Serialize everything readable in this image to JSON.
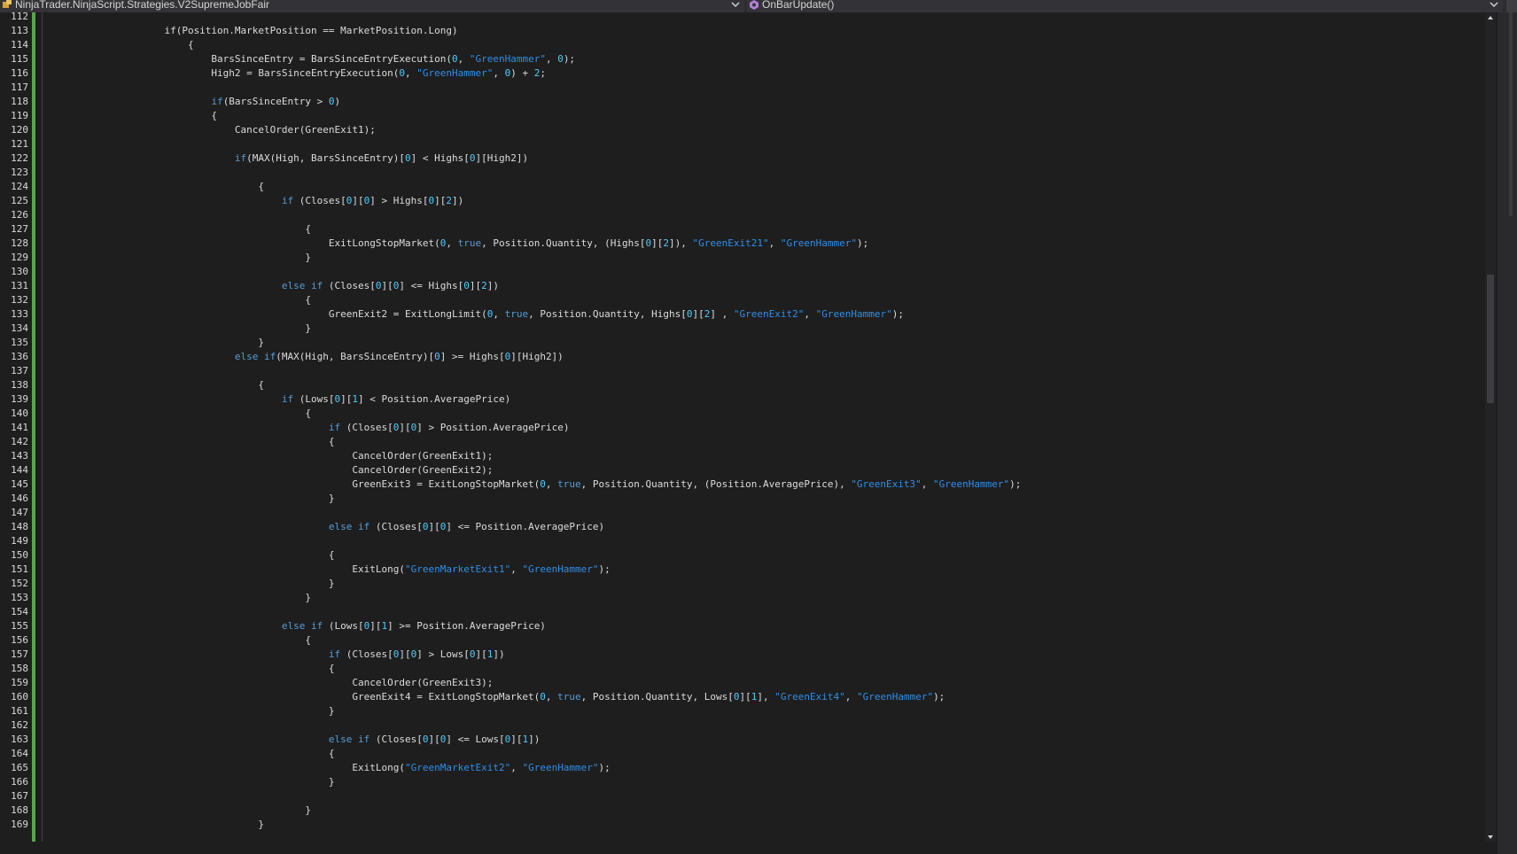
{
  "nav": {
    "type_dropdown": "NinjaTrader.NinjaScript.Strategies.V2SupremeJobFair",
    "member_dropdown": "OnBarUpdate()"
  },
  "icons": {
    "type_icon": "class-icon",
    "member_icon": "method-icon",
    "chevron": "chevron-down-icon"
  },
  "colors": {
    "background": "#1e1e1e",
    "keyword": "#569cd6",
    "string": "#2f8ee8",
    "number": "#4ec9ff",
    "change_bar": "#57a64a"
  },
  "editor": {
    "lines": [
      {
        "n": "112",
        "t": []
      },
      {
        "n": "113",
        "t": [
          [
            "",
            "                    if(Position.MarketPosition == MarketPosition.Long)"
          ]
        ]
      },
      {
        "n": "114",
        "t": [
          [
            "",
            "                        {"
          ]
        ]
      },
      {
        "n": "115",
        "t": [
          [
            "",
            "                            BarsSinceEntry = BarsSinceEntryExecution("
          ],
          [
            "n",
            "0"
          ],
          [
            "",
            ", "
          ],
          [
            "str",
            "\"GreenHammer\""
          ],
          [
            "",
            ", "
          ],
          [
            "n",
            "0"
          ],
          [
            "",
            ");"
          ]
        ]
      },
      {
        "n": "116",
        "t": [
          [
            "",
            "                            High2 = BarsSinceEntryExecution("
          ],
          [
            "n",
            "0"
          ],
          [
            "",
            ", "
          ],
          [
            "str",
            "\"GreenHammer\""
          ],
          [
            "",
            ", "
          ],
          [
            "n",
            "0"
          ],
          [
            "",
            ") + "
          ],
          [
            "n",
            "2"
          ],
          [
            "",
            ";"
          ]
        ]
      },
      {
        "n": "117",
        "t": []
      },
      {
        "n": "118",
        "t": [
          [
            "",
            "                            "
          ],
          [
            "kw",
            "if"
          ],
          [
            "",
            "(BarsSinceEntry > "
          ],
          [
            "n",
            "0"
          ],
          [
            "",
            ")"
          ]
        ]
      },
      {
        "n": "119",
        "t": [
          [
            "",
            "                            {"
          ]
        ]
      },
      {
        "n": "120",
        "t": [
          [
            "",
            "                                CancelOrder(GreenExit1);"
          ]
        ]
      },
      {
        "n": "121",
        "t": []
      },
      {
        "n": "122",
        "t": [
          [
            "",
            "                                "
          ],
          [
            "kw",
            "if"
          ],
          [
            "",
            "(MAX(High, BarsSinceEntry)["
          ],
          [
            "n",
            "0"
          ],
          [
            "",
            "] < Highs["
          ],
          [
            "n",
            "0"
          ],
          [
            "",
            "][High2])"
          ]
        ]
      },
      {
        "n": "123",
        "t": []
      },
      {
        "n": "124",
        "t": [
          [
            "",
            "                                    {"
          ]
        ]
      },
      {
        "n": "125",
        "t": [
          [
            "",
            "                                        "
          ],
          [
            "kw",
            "if"
          ],
          [
            "",
            " (Closes["
          ],
          [
            "n",
            "0"
          ],
          [
            "",
            "]["
          ],
          [
            "n",
            "0"
          ],
          [
            "",
            "] > Highs["
          ],
          [
            "n",
            "0"
          ],
          [
            "",
            "]["
          ],
          [
            "n",
            "2"
          ],
          [
            "",
            "])"
          ]
        ]
      },
      {
        "n": "126",
        "t": []
      },
      {
        "n": "127",
        "t": [
          [
            "",
            "                                            {"
          ]
        ]
      },
      {
        "n": "128",
        "t": [
          [
            "",
            "                                                ExitLongStopMarket("
          ],
          [
            "n",
            "0"
          ],
          [
            "",
            ", "
          ],
          [
            "kw",
            "true"
          ],
          [
            "",
            ", Position.Quantity, (Highs["
          ],
          [
            "n",
            "0"
          ],
          [
            "",
            "]["
          ],
          [
            "n",
            "2"
          ],
          [
            "",
            "]), "
          ],
          [
            "str",
            "\"GreenExit21\""
          ],
          [
            "",
            ", "
          ],
          [
            "str",
            "\"GreenHammer\""
          ],
          [
            "",
            ");"
          ]
        ]
      },
      {
        "n": "129",
        "t": [
          [
            "",
            "                                            }"
          ]
        ]
      },
      {
        "n": "130",
        "t": []
      },
      {
        "n": "131",
        "t": [
          [
            "",
            "                                        "
          ],
          [
            "kw",
            "else if"
          ],
          [
            "",
            " (Closes["
          ],
          [
            "n",
            "0"
          ],
          [
            "",
            "]["
          ],
          [
            "n",
            "0"
          ],
          [
            "",
            "] <= Highs["
          ],
          [
            "n",
            "0"
          ],
          [
            "",
            "]["
          ],
          [
            "n",
            "2"
          ],
          [
            "",
            "])"
          ]
        ]
      },
      {
        "n": "132",
        "t": [
          [
            "",
            "                                            {"
          ]
        ]
      },
      {
        "n": "133",
        "t": [
          [
            "",
            "                                                GreenExit2 = ExitLongLimit("
          ],
          [
            "n",
            "0"
          ],
          [
            "",
            ", "
          ],
          [
            "kw",
            "true"
          ],
          [
            "",
            ", Position.Quantity, Highs["
          ],
          [
            "n",
            "0"
          ],
          [
            "",
            "]["
          ],
          [
            "n",
            "2"
          ],
          [
            "",
            "] , "
          ],
          [
            "str",
            "\"GreenExit2\""
          ],
          [
            "",
            ", "
          ],
          [
            "str",
            "\"GreenHammer\""
          ],
          [
            "",
            ");"
          ]
        ]
      },
      {
        "n": "134",
        "t": [
          [
            "",
            "                                            }"
          ]
        ]
      },
      {
        "n": "135",
        "t": [
          [
            "",
            "                                    }"
          ]
        ]
      },
      {
        "n": "136",
        "t": [
          [
            "",
            "                                "
          ],
          [
            "kw",
            "else if"
          ],
          [
            "",
            "(MAX(High, BarsSinceEntry)["
          ],
          [
            "n",
            "0"
          ],
          [
            "",
            "] >= Highs["
          ],
          [
            "n",
            "0"
          ],
          [
            "",
            "][High2])"
          ]
        ]
      },
      {
        "n": "137",
        "t": []
      },
      {
        "n": "138",
        "t": [
          [
            "",
            "                                    {"
          ]
        ]
      },
      {
        "n": "139",
        "t": [
          [
            "",
            "                                        "
          ],
          [
            "kw",
            "if"
          ],
          [
            "",
            " (Lows["
          ],
          [
            "n",
            "0"
          ],
          [
            "",
            "]["
          ],
          [
            "n",
            "1"
          ],
          [
            "",
            "] < Position.AveragePrice)"
          ]
        ]
      },
      {
        "n": "140",
        "t": [
          [
            "",
            "                                            {"
          ]
        ]
      },
      {
        "n": "141",
        "t": [
          [
            "",
            "                                                "
          ],
          [
            "kw",
            "if"
          ],
          [
            "",
            " (Closes["
          ],
          [
            "n",
            "0"
          ],
          [
            "",
            "]["
          ],
          [
            "n",
            "0"
          ],
          [
            "",
            "] > Position.AveragePrice)"
          ]
        ]
      },
      {
        "n": "142",
        "t": [
          [
            "",
            "                                                {"
          ]
        ]
      },
      {
        "n": "143",
        "t": [
          [
            "",
            "                                                    CancelOrder(GreenExit1);"
          ]
        ]
      },
      {
        "n": "144",
        "t": [
          [
            "",
            "                                                    CancelOrder(GreenExit2);"
          ]
        ]
      },
      {
        "n": "145",
        "t": [
          [
            "",
            "                                                    GreenExit3 = ExitLongStopMarket("
          ],
          [
            "n",
            "0"
          ],
          [
            "",
            ", "
          ],
          [
            "kw",
            "true"
          ],
          [
            "",
            ", Position.Quantity, (Position.AveragePrice), "
          ],
          [
            "str",
            "\"GreenExit3\""
          ],
          [
            "",
            ", "
          ],
          [
            "str",
            "\"GreenHammer\""
          ],
          [
            "",
            ");"
          ]
        ]
      },
      {
        "n": "146",
        "t": [
          [
            "",
            "                                                }"
          ]
        ]
      },
      {
        "n": "147",
        "t": []
      },
      {
        "n": "148",
        "t": [
          [
            "",
            "                                                "
          ],
          [
            "kw",
            "else if"
          ],
          [
            "",
            " (Closes["
          ],
          [
            "n",
            "0"
          ],
          [
            "",
            "]["
          ],
          [
            "n",
            "0"
          ],
          [
            "",
            "] <= Position.AveragePrice)"
          ]
        ]
      },
      {
        "n": "149",
        "t": []
      },
      {
        "n": "150",
        "t": [
          [
            "",
            "                                                {"
          ]
        ]
      },
      {
        "n": "151",
        "t": [
          [
            "",
            "                                                    ExitLong("
          ],
          [
            "str",
            "\"GreenMarketExit1\""
          ],
          [
            "",
            ", "
          ],
          [
            "str",
            "\"GreenHammer\""
          ],
          [
            "",
            ");"
          ]
        ]
      },
      {
        "n": "152",
        "t": [
          [
            "",
            "                                                }"
          ]
        ]
      },
      {
        "n": "153",
        "t": [
          [
            "",
            "                                            }"
          ]
        ]
      },
      {
        "n": "154",
        "t": []
      },
      {
        "n": "155",
        "t": [
          [
            "",
            "                                        "
          ],
          [
            "kw",
            "else if"
          ],
          [
            "",
            " (Lows["
          ],
          [
            "n",
            "0"
          ],
          [
            "",
            "]["
          ],
          [
            "n",
            "1"
          ],
          [
            "",
            "] >= Position.AveragePrice)"
          ]
        ]
      },
      {
        "n": "156",
        "t": [
          [
            "",
            "                                            {"
          ]
        ]
      },
      {
        "n": "157",
        "t": [
          [
            "",
            "                                                "
          ],
          [
            "kw",
            "if"
          ],
          [
            "",
            " (Closes["
          ],
          [
            "n",
            "0"
          ],
          [
            "",
            "]["
          ],
          [
            "n",
            "0"
          ],
          [
            "",
            "] > Lows["
          ],
          [
            "n",
            "0"
          ],
          [
            "",
            "]["
          ],
          [
            "n",
            "1"
          ],
          [
            "",
            "])"
          ]
        ]
      },
      {
        "n": "158",
        "t": [
          [
            "",
            "                                                {"
          ]
        ]
      },
      {
        "n": "159",
        "t": [
          [
            "",
            "                                                    CancelOrder(GreenExit3);"
          ]
        ]
      },
      {
        "n": "160",
        "t": [
          [
            "",
            "                                                    GreenExit4 = ExitLongStopMarket("
          ],
          [
            "n",
            "0"
          ],
          [
            "",
            ", "
          ],
          [
            "kw",
            "true"
          ],
          [
            "",
            ", Position.Quantity, Lows["
          ],
          [
            "n",
            "0"
          ],
          [
            "",
            "]["
          ],
          [
            "n",
            "1"
          ],
          [
            "",
            "], "
          ],
          [
            "str",
            "\"GreenExit4\""
          ],
          [
            "",
            ", "
          ],
          [
            "str",
            "\"GreenHammer\""
          ],
          [
            "",
            ");"
          ]
        ]
      },
      {
        "n": "161",
        "t": [
          [
            "",
            "                                                }"
          ]
        ]
      },
      {
        "n": "162",
        "t": []
      },
      {
        "n": "163",
        "t": [
          [
            "",
            "                                                "
          ],
          [
            "kw",
            "else if"
          ],
          [
            "",
            " (Closes["
          ],
          [
            "n",
            "0"
          ],
          [
            "",
            "]["
          ],
          [
            "n",
            "0"
          ],
          [
            "",
            "] <= Lows["
          ],
          [
            "n",
            "0"
          ],
          [
            "",
            "]["
          ],
          [
            "n",
            "1"
          ],
          [
            "",
            "])"
          ]
        ]
      },
      {
        "n": "164",
        "t": [
          [
            "",
            "                                                {"
          ]
        ]
      },
      {
        "n": "165",
        "t": [
          [
            "",
            "                                                    ExitLong("
          ],
          [
            "str",
            "\"GreenMarketExit2\""
          ],
          [
            "",
            ", "
          ],
          [
            "str",
            "\"GreenHammer\""
          ],
          [
            "",
            ");"
          ]
        ]
      },
      {
        "n": "166",
        "t": [
          [
            "",
            "                                                }"
          ]
        ]
      },
      {
        "n": "167",
        "t": []
      },
      {
        "n": "168",
        "t": [
          [
            "",
            "                                            }"
          ]
        ]
      },
      {
        "n": "169",
        "t": [
          [
            "",
            "                                    }"
          ]
        ]
      }
    ]
  }
}
